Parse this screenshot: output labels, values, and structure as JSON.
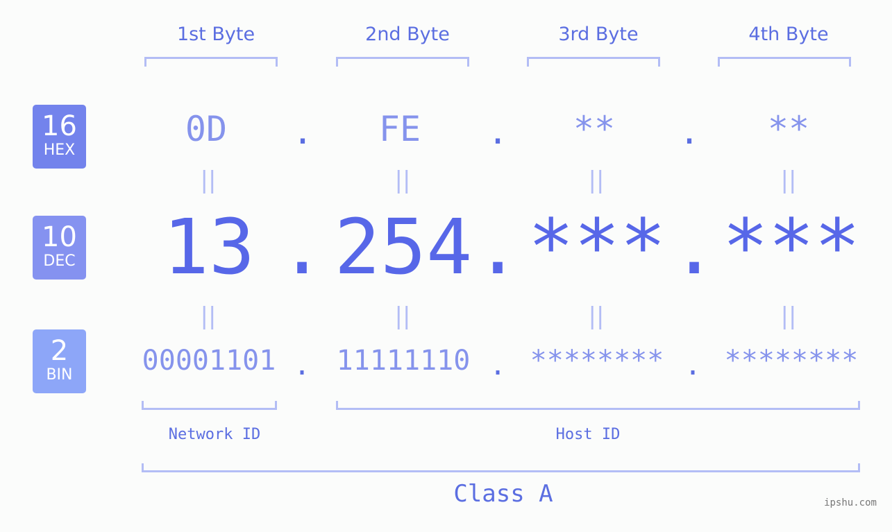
{
  "colors": {
    "hex_badge": "#7383ec",
    "dec_badge": "#8592f0",
    "bin_badge": "#8da6f8",
    "accent": "#5767e8",
    "light_value": "#8593ec",
    "bracket": "#b3bdf5"
  },
  "badges": [
    {
      "number": "16",
      "label": "HEX"
    },
    {
      "number": "10",
      "label": "DEC"
    },
    {
      "number": "2",
      "label": "BIN"
    }
  ],
  "byte_titles": [
    "1st Byte",
    "2nd Byte",
    "3rd Byte",
    "4th Byte"
  ],
  "separator": ".",
  "equals_glyph": "||",
  "hex": [
    "0D",
    "FE",
    "**",
    "**"
  ],
  "dec": [
    "13",
    "254",
    "***",
    "***"
  ],
  "bin": [
    "00001101",
    "11111110",
    "********",
    "********"
  ],
  "network_id_label": "Network ID",
  "host_id_label": "Host ID",
  "class_label": "Class A",
  "watermark": "ipshu.com"
}
